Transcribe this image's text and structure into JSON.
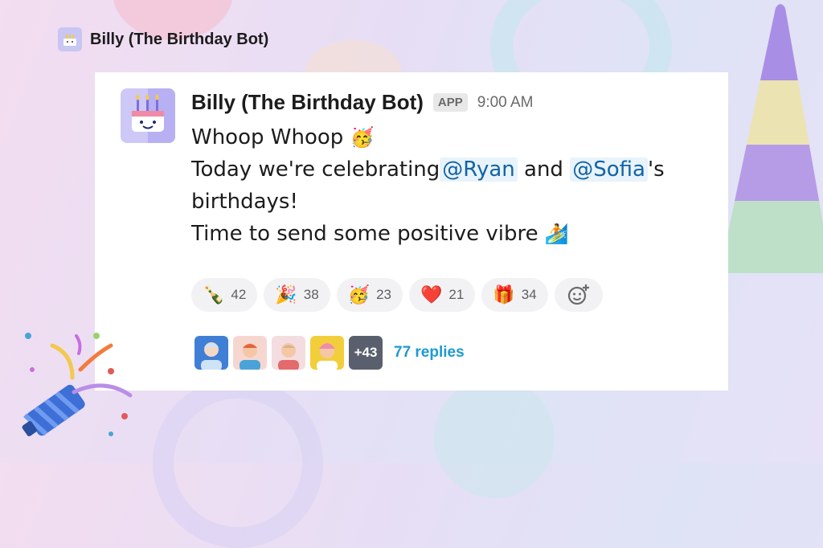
{
  "header": {
    "title": "Billy (The Birthday Bot)"
  },
  "message": {
    "sender": "Billy (The Birthday Bot)",
    "badge": "APP",
    "time": "9:00 AM",
    "line1": "Whoop Whoop",
    "line1_emoji": "🥳",
    "line2_pre": "Today we're celebrating",
    "mention1": "@Ryan",
    "line2_mid": " and ",
    "mention2": "@Sofia",
    "line2_post": "'s",
    "line3": "birthdays!",
    "line4": "Time to send some positive vibre",
    "line4_emoji": "🏄"
  },
  "reactions": [
    {
      "emoji": "🍾",
      "icon": "champagne-icon",
      "count": "42"
    },
    {
      "emoji": "🎉",
      "icon": "party-popper-icon",
      "count": "38"
    },
    {
      "emoji": "🥳",
      "icon": "partying-face-icon",
      "count": "23"
    },
    {
      "emoji": "❤️",
      "icon": "heart-icon",
      "count": "21"
    },
    {
      "emoji": "🎁",
      "icon": "gift-icon",
      "count": "34"
    }
  ],
  "thread": {
    "more_count": "+43",
    "replies_label": "77 replies",
    "avatar_colors": [
      "#3f7fd6",
      "#f6d7d0",
      "#f3dde0",
      "#f2cf3a"
    ]
  },
  "colors": {
    "mention": "#1264a3",
    "replies": "#1d9bd1",
    "avatar_bg": "#cdc8f6"
  }
}
